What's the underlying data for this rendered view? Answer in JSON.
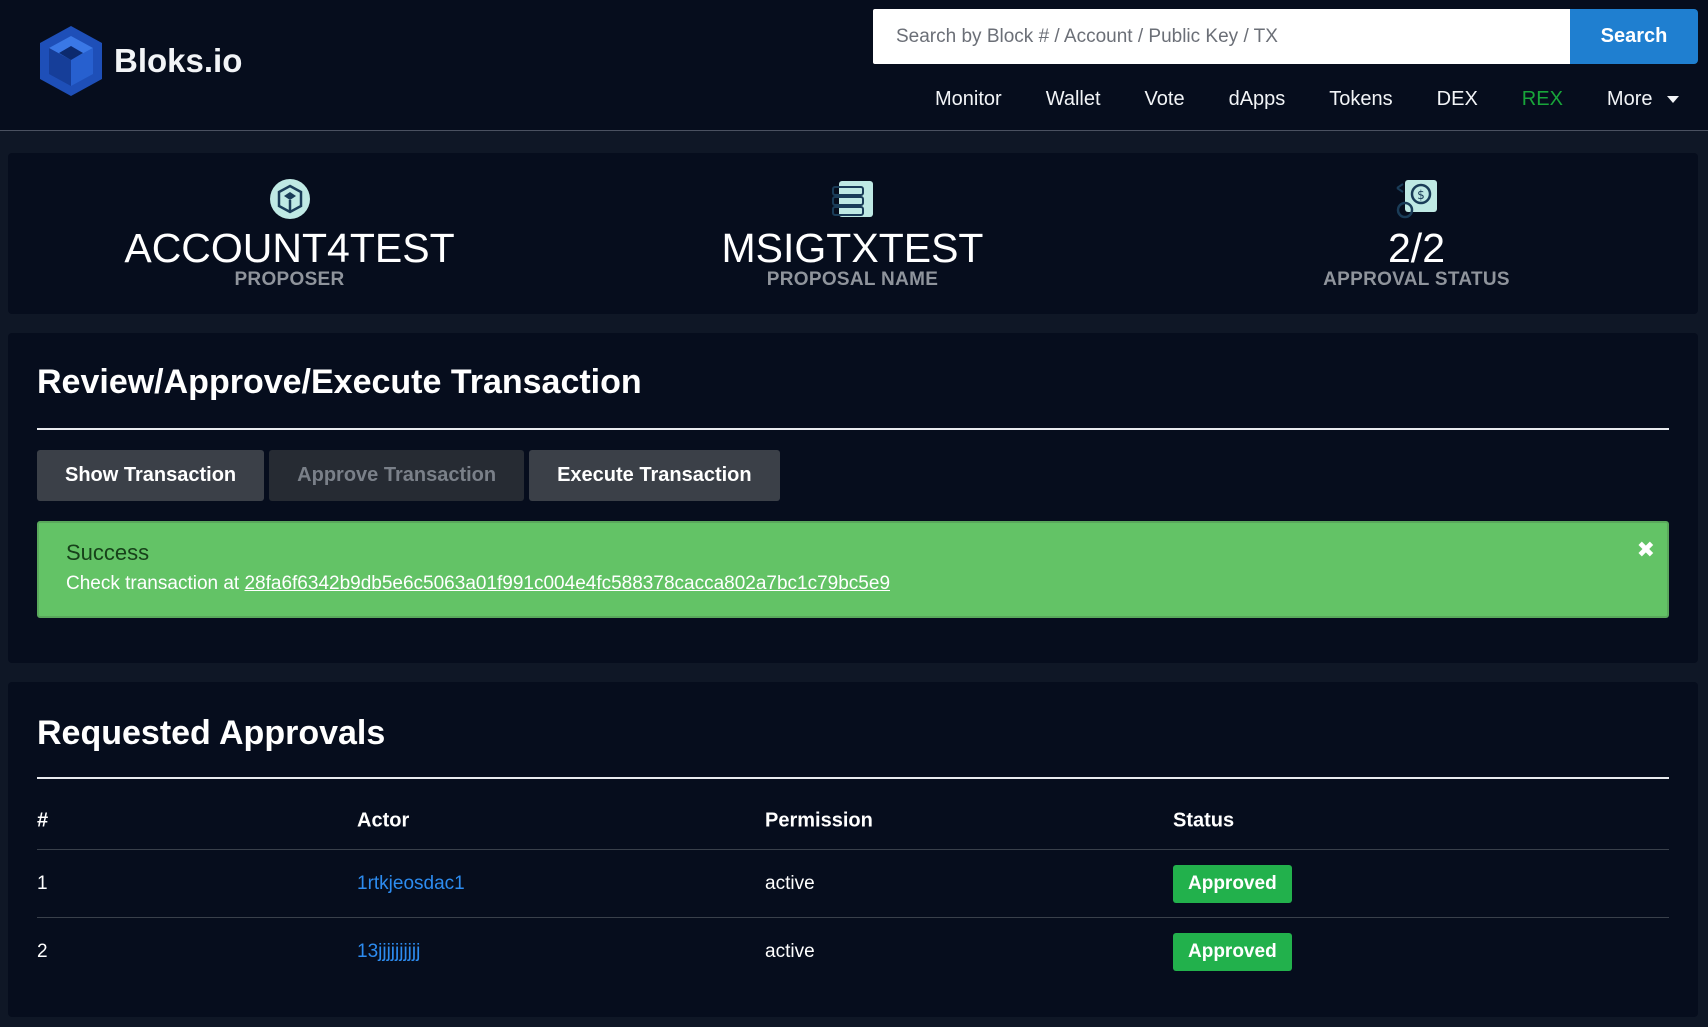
{
  "header": {
    "logo_text": "Bloks.io",
    "search": {
      "placeholder": "Search by Block # / Account / Public Key / TX",
      "button_label": "Search"
    },
    "nav": [
      "Monitor",
      "Wallet",
      "Vote",
      "dApps",
      "Tokens",
      "DEX",
      "REX",
      "More"
    ]
  },
  "stats": [
    {
      "value": "ACCOUNT4TEST",
      "label": "PROPOSER",
      "icon": "proposer-icon"
    },
    {
      "value": "MSIGTXTEST",
      "label": "PROPOSAL NAME",
      "icon": "proposal-name-icon"
    },
    {
      "value": "2/2",
      "label": "APPROVAL STATUS",
      "icon": "approval-status-icon"
    }
  ],
  "review": {
    "title": "Review/Approve/Execute Transaction",
    "buttons": {
      "show": "Show Transaction",
      "approve": "Approve Transaction",
      "execute": "Execute Transaction"
    },
    "alert": {
      "title": "Success",
      "prefix": "Check transaction at",
      "tx": "28fa6f6342b9db5e6c5063a01f991c004e4fc588378cacca802a7bc1c79bc5e9"
    }
  },
  "approvals": {
    "title": "Requested Approvals",
    "columns": [
      "#",
      "Actor",
      "Permission",
      "Status"
    ],
    "rows": [
      {
        "num": "1",
        "actor": "1rtkjeosdac1",
        "permission": "active",
        "status": "Approved"
      },
      {
        "num": "2",
        "actor": "13jjjjjjjjjj",
        "permission": "active",
        "status": "Approved"
      }
    ]
  },
  "colors": {
    "accent": "#1f7fd0",
    "rex": "#18a53a",
    "success": "#63c366",
    "badge": "#22b14c",
    "link": "#2d8cf0"
  }
}
